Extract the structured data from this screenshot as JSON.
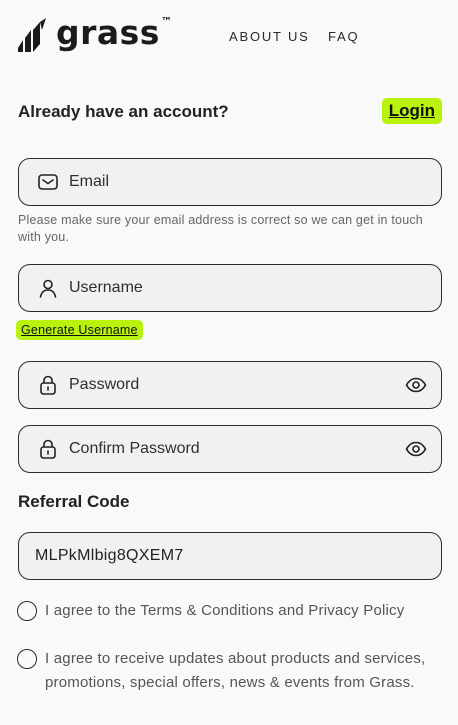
{
  "brand": {
    "name": "grass",
    "tm": "™"
  },
  "nav": {
    "about": "ABOUT US",
    "faq": "FAQ"
  },
  "account": {
    "question": "Already have an account?",
    "login": "Login"
  },
  "email": {
    "placeholder": "Email",
    "icon": "mail-icon",
    "hint": "Please make sure your email address is correct so we can get in touch with you."
  },
  "username": {
    "placeholder": "Username",
    "icon": "user-icon",
    "generate": "Generate Username"
  },
  "password": {
    "placeholder": "Password",
    "icon": "lock-icon"
  },
  "confirm": {
    "placeholder": "Confirm Password",
    "icon": "lock-icon"
  },
  "referral": {
    "label": "Referral Code",
    "value": "MLPkMlbig8QXEM7"
  },
  "checks": {
    "terms": "I agree to the Terms & Conditions and Privacy Policy",
    "updates": "I agree to receive updates about products and services, promotions, special offers, news & events from Grass."
  },
  "colors": {
    "accent": "#b9f20c",
    "background": "#f9f9f9",
    "field": "#f1f1f1",
    "border": "#2b2b2b"
  }
}
